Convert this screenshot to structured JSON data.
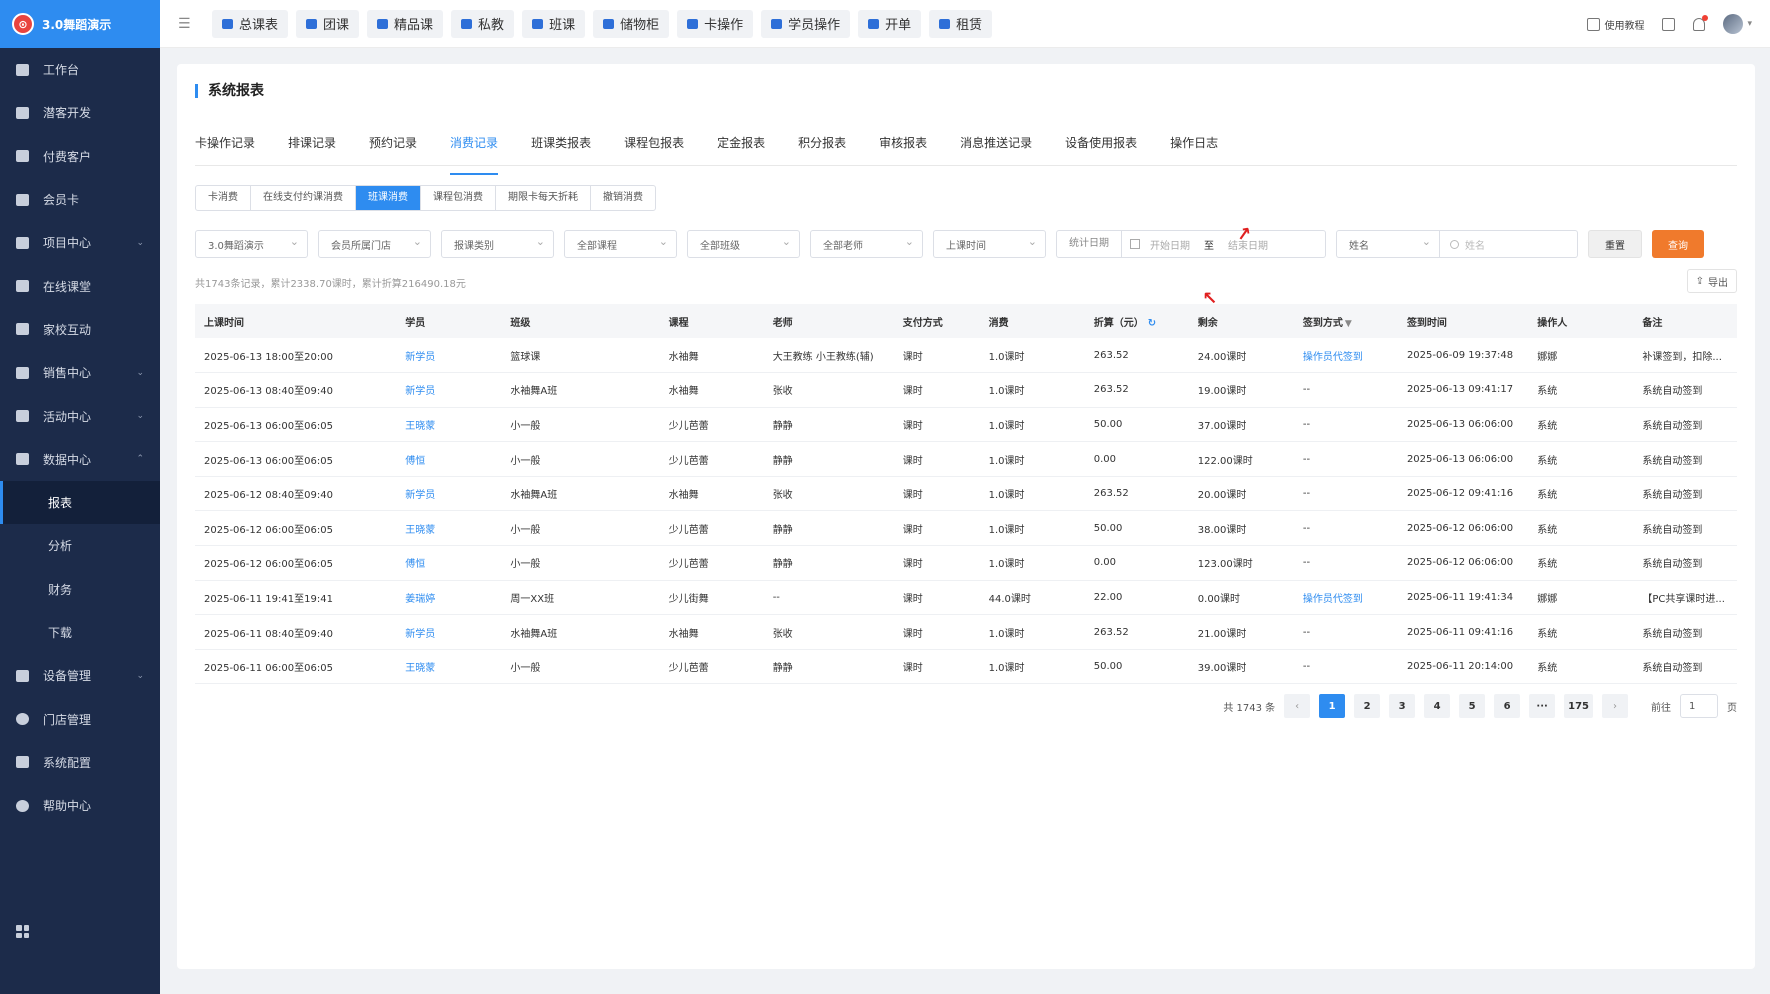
{
  "app": {
    "name": "3.0舞蹈演示",
    "logo_glyph": "⊙"
  },
  "sidebar": {
    "items": [
      {
        "label": "工作台",
        "icon": "dashboard-icon"
      },
      {
        "label": "潜客开发",
        "icon": "prospect-icon"
      },
      {
        "label": "付费客户",
        "icon": "customers-icon"
      },
      {
        "label": "会员卡",
        "icon": "card-icon"
      },
      {
        "label": "项目中心",
        "icon": "project-icon",
        "expandable": true
      },
      {
        "label": "在线课堂",
        "icon": "classroom-icon"
      },
      {
        "label": "家校互动",
        "icon": "interaction-icon"
      },
      {
        "label": "销售中心",
        "icon": "sales-icon",
        "expandable": true
      },
      {
        "label": "活动中心",
        "icon": "activity-icon",
        "expandable": true
      },
      {
        "label": "数据中心",
        "icon": "data-icon",
        "expanded": true
      }
    ],
    "sub_items": [
      {
        "label": "报表",
        "active": true
      },
      {
        "label": "分析"
      },
      {
        "label": "财务"
      },
      {
        "label": "下载"
      }
    ],
    "items_after": [
      {
        "label": "设备管理",
        "icon": "device-icon",
        "expandable": true
      },
      {
        "label": "门店管理",
        "icon": "store-icon"
      },
      {
        "label": "系统配置",
        "icon": "settings-icon"
      },
      {
        "label": "帮助中心",
        "icon": "help-icon"
      }
    ]
  },
  "topbar": {
    "quick_links": [
      "总课表",
      "团课",
      "精品课",
      "私教",
      "班课",
      "储物柜",
      "卡操作",
      "学员操作",
      "开单",
      "租赁"
    ],
    "tutorial": "使用教程"
  },
  "page": {
    "title": "系统报表",
    "tabs": [
      "卡操作记录",
      "排课记录",
      "预约记录",
      "消费记录",
      "班课类报表",
      "课程包报表",
      "定金报表",
      "积分报表",
      "审核报表",
      "消息推送记录",
      "设备使用报表",
      "操作日志"
    ],
    "active_tab": 3,
    "subtabs": [
      "卡消费",
      "在线支付约课消费",
      "班课消费",
      "课程包消费",
      "期限卡每天折耗",
      "撤销消费"
    ],
    "active_subtab": 2
  },
  "filters": {
    "store": "3.0舞蹈演示",
    "member_store": "会员所属门店",
    "report_type": "报课类别",
    "course": "全部课程",
    "class": "全部班级",
    "teacher": "全部老师",
    "time_type": "上课时间",
    "date_label": "统计日期",
    "start_placeholder": "开始日期",
    "range_sep": "至",
    "end_placeholder": "结束日期",
    "search_field": "姓名",
    "search_placeholder": "姓名",
    "reset": "重置",
    "query": "查询"
  },
  "summary": "共1743条记录，累计2338.70课时，累计折算216490.18元",
  "export_label": "导出",
  "table": {
    "headers": [
      "上课时间",
      "学员",
      "班级",
      "课程",
      "老师",
      "支付方式",
      "消费",
      "折算（元）",
      "剩余",
      "签到方式",
      "签到时间",
      "操作人",
      "备注"
    ],
    "rows": [
      [
        "2025-06-13 18:00至20:00",
        "新学员",
        "篮球课",
        "水袖舞",
        "大王教练 小王教练(辅)",
        "课时",
        "1.0课时",
        "263.52",
        "24.00课时",
        "操作员代签到",
        "2025-06-09 19:37:48",
        "娜娜",
        "补课签到，扣除..."
      ],
      [
        "2025-06-13 08:40至09:40",
        "新学员",
        "水袖舞A班",
        "水袖舞",
        "张收",
        "课时",
        "1.0课时",
        "263.52",
        "19.00课时",
        "--",
        "2025-06-13 09:41:17",
        "系统",
        "系统自动签到"
      ],
      [
        "2025-06-13 06:00至06:05",
        "王晓蒙",
        "小一般",
        "少儿芭蕾",
        "静静",
        "课时",
        "1.0课时",
        "50.00",
        "37.00课时",
        "--",
        "2025-06-13 06:06:00",
        "系统",
        "系统自动签到"
      ],
      [
        "2025-06-13 06:00至06:05",
        "傅恒",
        "小一般",
        "少儿芭蕾",
        "静静",
        "课时",
        "1.0课时",
        "0.00",
        "122.00课时",
        "--",
        "2025-06-13 06:06:00",
        "系统",
        "系统自动签到"
      ],
      [
        "2025-06-12 08:40至09:40",
        "新学员",
        "水袖舞A班",
        "水袖舞",
        "张收",
        "课时",
        "1.0课时",
        "263.52",
        "20.00课时",
        "--",
        "2025-06-12 09:41:16",
        "系统",
        "系统自动签到"
      ],
      [
        "2025-06-12 06:00至06:05",
        "王晓蒙",
        "小一般",
        "少儿芭蕾",
        "静静",
        "课时",
        "1.0课时",
        "50.00",
        "38.00课时",
        "--",
        "2025-06-12 06:06:00",
        "系统",
        "系统自动签到"
      ],
      [
        "2025-06-12 06:00至06:05",
        "傅恒",
        "小一般",
        "少儿芭蕾",
        "静静",
        "课时",
        "1.0课时",
        "0.00",
        "123.00课时",
        "--",
        "2025-06-12 06:06:00",
        "系统",
        "系统自动签到"
      ],
      [
        "2025-06-11 19:41至19:41",
        "姜瑞婷",
        "周一XX班",
        "少儿街舞",
        "--",
        "课时",
        "44.0课时",
        "22.00",
        "0.00课时",
        "操作员代签到",
        "2025-06-11 19:41:34",
        "娜娜",
        "【PC共享课时进..."
      ],
      [
        "2025-06-11 08:40至09:40",
        "新学员",
        "水袖舞A班",
        "水袖舞",
        "张收",
        "课时",
        "1.0课时",
        "263.52",
        "21.00课时",
        "--",
        "2025-06-11 09:41:16",
        "系统",
        "系统自动签到"
      ],
      [
        "2025-06-11 06:00至06:05",
        "王晓蒙",
        "小一般",
        "少儿芭蕾",
        "静静",
        "课时",
        "1.0课时",
        "50.00",
        "39.00课时",
        "--",
        "2025-06-11 20:14:00",
        "系统",
        "系统自动签到"
      ]
    ]
  },
  "pagination": {
    "total_text": "共 1743 条",
    "pages": [
      "1",
      "2",
      "3",
      "4",
      "5",
      "6",
      "···",
      "175"
    ],
    "current": "1",
    "goto_label": "前往",
    "goto_value": "1",
    "page_suffix": "页"
  },
  "colors": {
    "sidebar_bg": "#1c2b4a",
    "accent": "#2e8cf0",
    "query_button": "#f07a2c",
    "annotation_arrow": "#e02020"
  }
}
